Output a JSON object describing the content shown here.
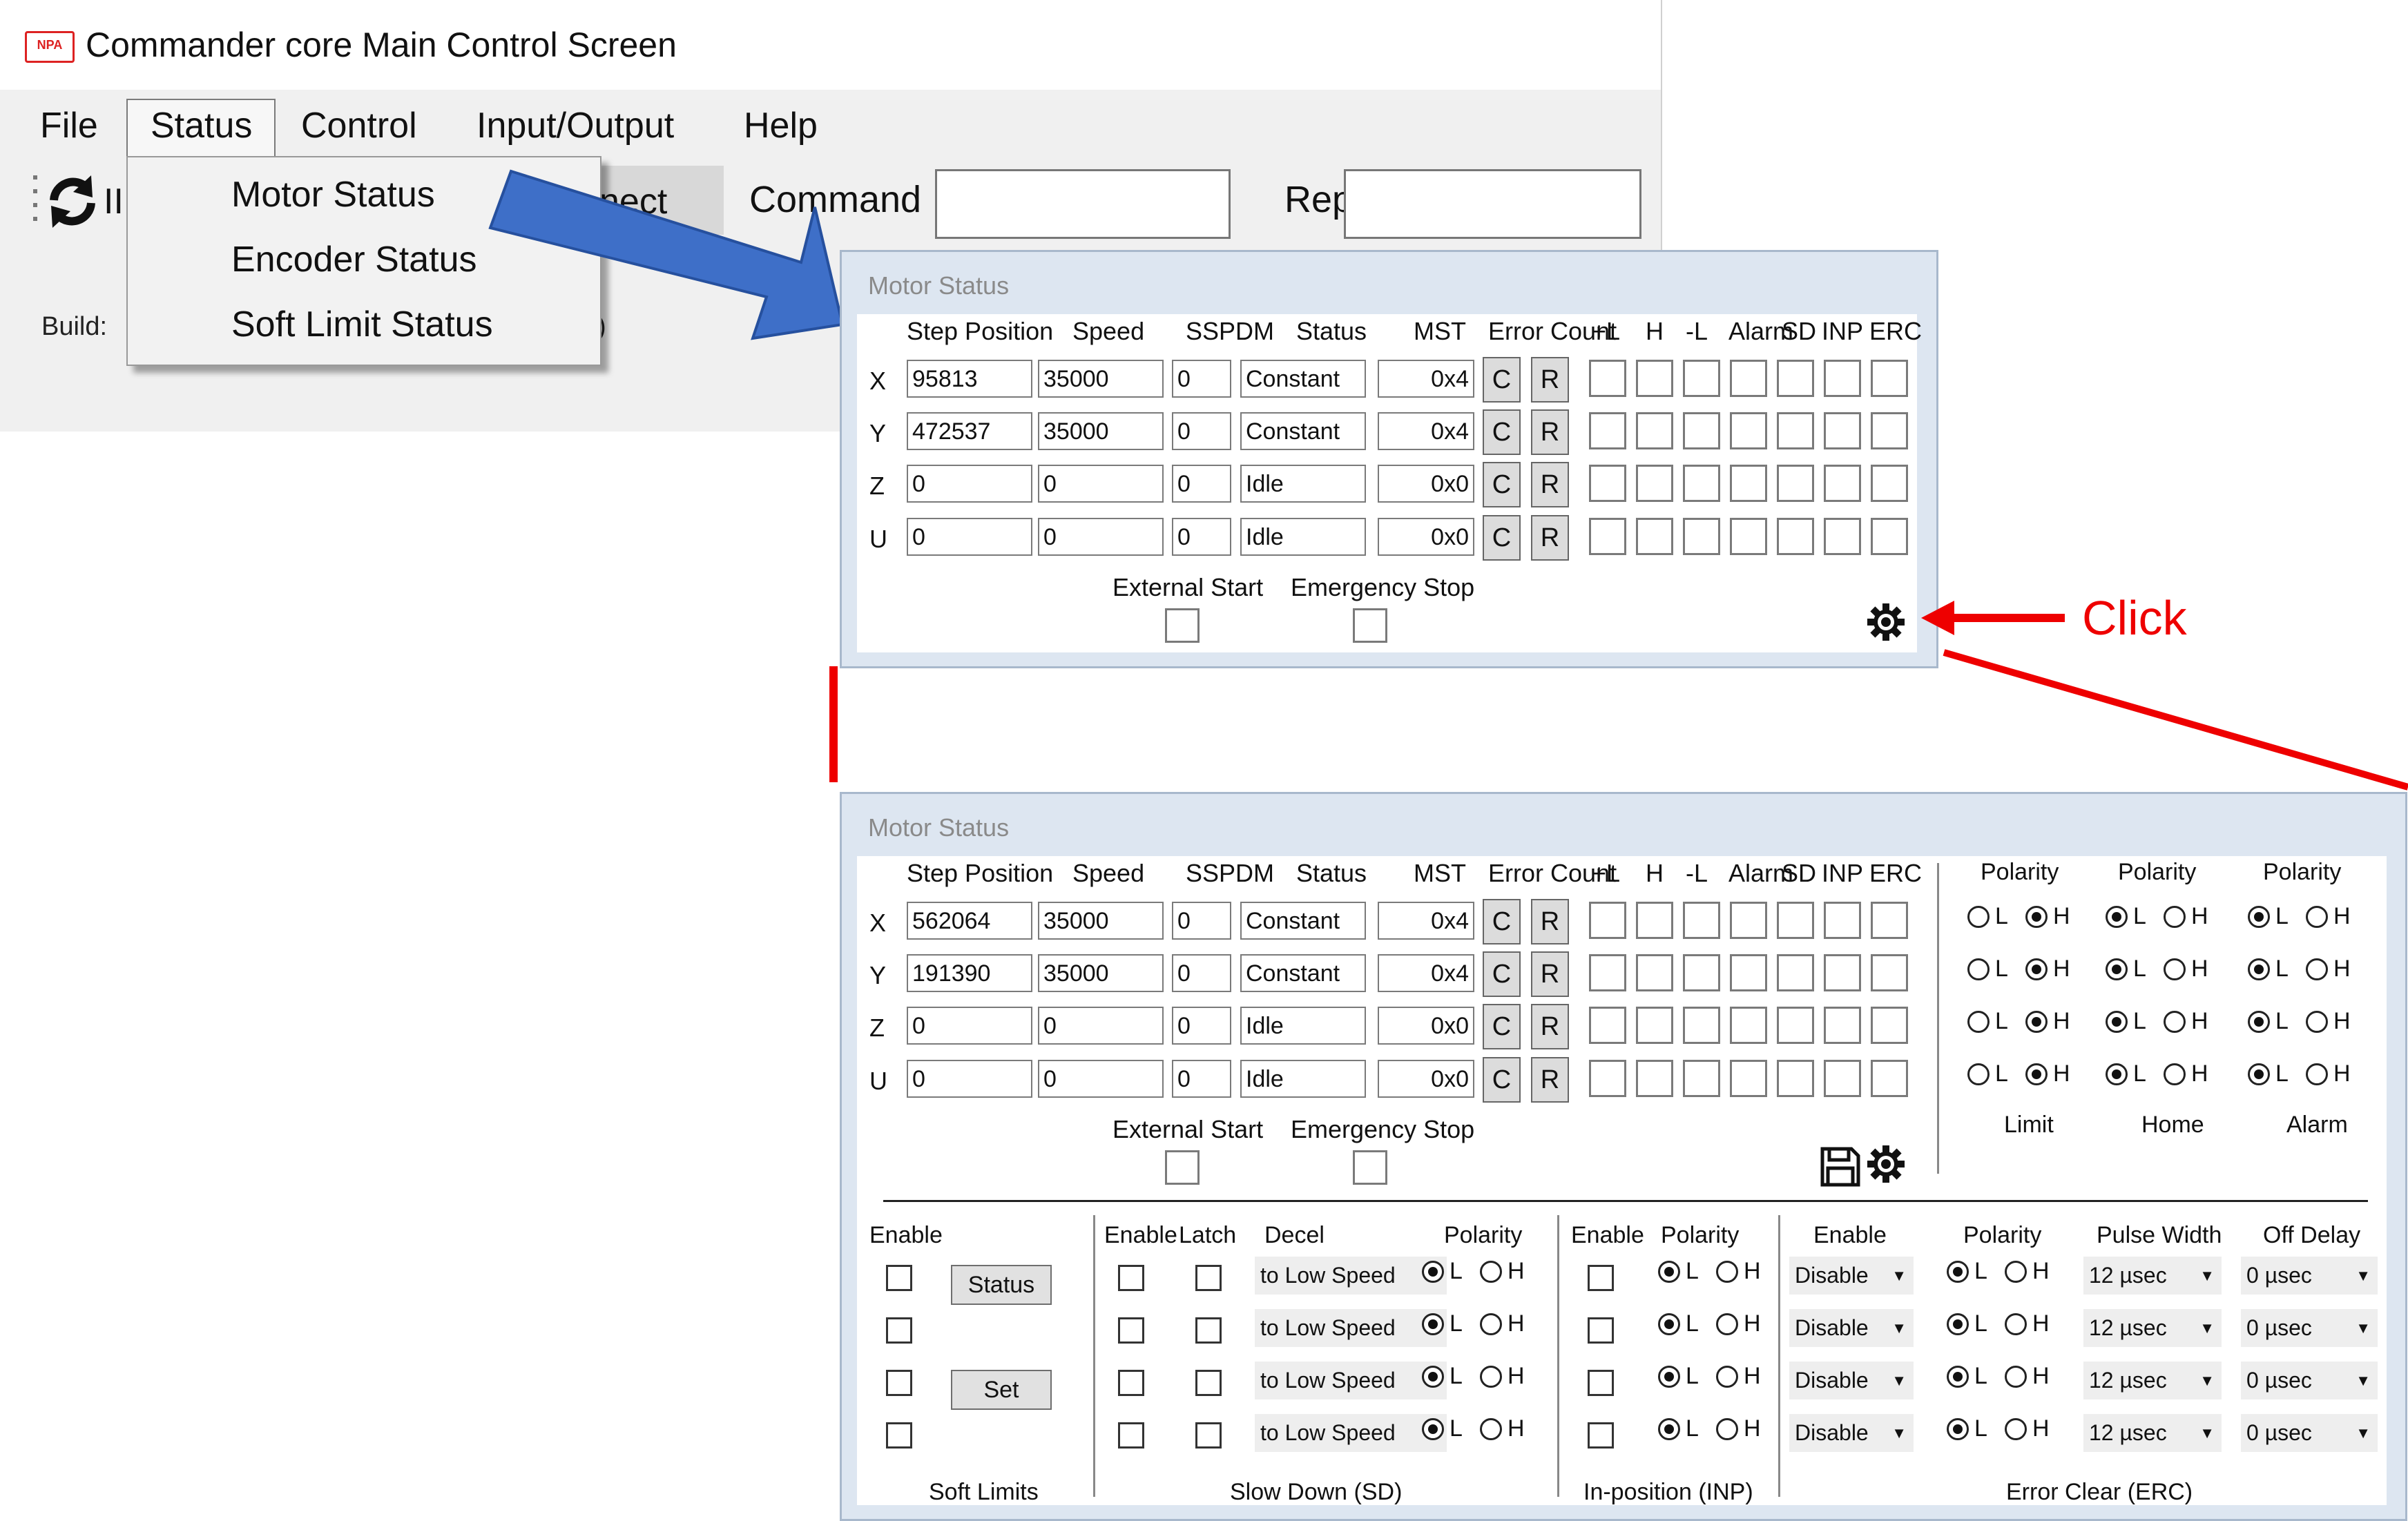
{
  "window": {
    "title": "Commander core Main Control Screen",
    "logo_text": "NPA"
  },
  "menu": [
    "File",
    "Status",
    "Control",
    "Input/Output",
    "Help"
  ],
  "toolbar": {
    "partial_label": "II",
    "connect_label": "nect",
    "command_label": "Command",
    "command_value": "",
    "reply_label": "Reply",
    "reply_value": ""
  },
  "build": {
    "label": "Build: ",
    "tail": ")"
  },
  "status_menu": [
    "Motor Status",
    "Encoder Status",
    "Soft Limit Status"
  ],
  "colors": {
    "arrow_blue": "#3e6fc8",
    "annotation_red": "#e00000",
    "dialog_frame": "#dde6f1"
  },
  "annotation": {
    "click_label": "Click"
  },
  "motor_status": {
    "title": "Motor Status",
    "headers": {
      "step_position": "Step Position",
      "speed": "Speed",
      "sspdm": "SSPDM",
      "status": "Status",
      "mst": "MST",
      "error_count": "Error Count",
      "plus_l": "+L",
      "h": "H",
      "minus_l": "-L",
      "alarm": "Alarm",
      "sd": "SD",
      "inp": "INP",
      "erc": "ERC"
    },
    "clear_label": "C",
    "reset_label": "R",
    "external_start": "External Start",
    "emergency_stop": "Emergency Stop",
    "settings_icon": "gear-icon",
    "save_icon": "save-icon"
  },
  "dialog_top": {
    "rows": [
      {
        "axis": "X",
        "step": "95813",
        "speed": "35000",
        "sspdm": "0",
        "status": "Constant",
        "mst": "0x4"
      },
      {
        "axis": "Y",
        "step": "472537",
        "speed": "35000",
        "sspdm": "0",
        "status": "Constant",
        "mst": "0x4"
      },
      {
        "axis": "Z",
        "step": "0",
        "speed": "0",
        "sspdm": "0",
        "status": "Idle",
        "mst": "0x0"
      },
      {
        "axis": "U",
        "step": "0",
        "speed": "0",
        "sspdm": "0",
        "status": "Idle",
        "mst": "0x0"
      }
    ]
  },
  "dialog_bottom": {
    "rows": [
      {
        "axis": "X",
        "step": "562064",
        "speed": "35000",
        "sspdm": "0",
        "status": "Constant",
        "mst": "0x4"
      },
      {
        "axis": "Y",
        "step": "191390",
        "speed": "35000",
        "sspdm": "0",
        "status": "Constant",
        "mst": "0x4"
      },
      {
        "axis": "Z",
        "step": "0",
        "speed": "0",
        "sspdm": "0",
        "status": "Idle",
        "mst": "0x0"
      },
      {
        "axis": "U",
        "step": "0",
        "speed": "0",
        "sspdm": "0",
        "status": "Idle",
        "mst": "0x0"
      }
    ],
    "polarity_header": "Polarity",
    "polarity_groups": [
      "Limit",
      "Home",
      "Alarm"
    ],
    "polarity_selected": [
      "H",
      "L",
      "L"
    ],
    "radio_low": "L",
    "radio_high": "H",
    "soft_limits": {
      "enable_header": "Enable",
      "status_button": "Status",
      "set_button": "Set",
      "caption": "Soft Limits"
    },
    "slow_down": {
      "enable_header": "Enable",
      "latch_header": "Latch",
      "decel_header": "Decel",
      "polarity_header": "Polarity",
      "decel_value": "to Low Speed",
      "polarity_selected": "L",
      "caption": "Slow Down (SD)"
    },
    "in_position": {
      "enable_header": "Enable",
      "polarity_header": "Polarity",
      "polarity_selected": "L",
      "caption": "In-position (INP)"
    },
    "error_clear": {
      "enable_header": "Enable",
      "polarity_header": "Polarity",
      "pulse_width_header": "Pulse Width",
      "off_delay_header": "Off Delay",
      "enable_value": "Disable",
      "polarity_selected": "L",
      "pulse_width_value": "12 µsec",
      "off_delay_value": "0 µsec",
      "caption": "Error Clear (ERC)"
    }
  }
}
